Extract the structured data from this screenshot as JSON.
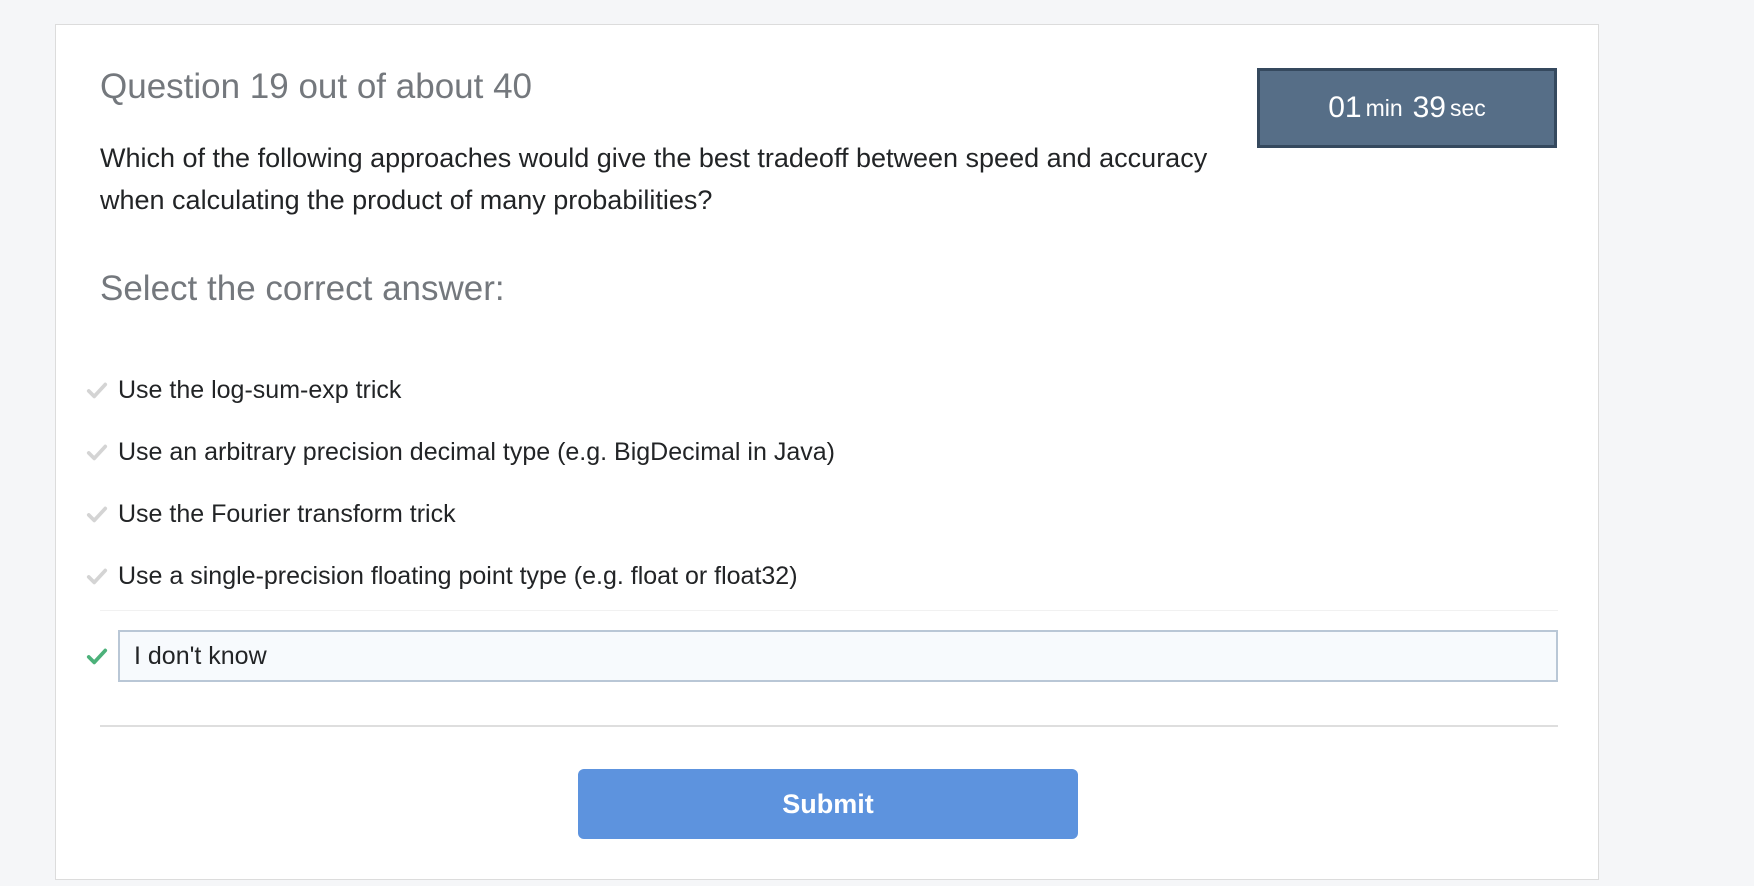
{
  "question": {
    "header": "Question 19 out of about 40",
    "text": "Which of the following approaches would give the best tradeoff between speed and accuracy when calculating the product of many probabilities?"
  },
  "timer": {
    "minutes": "01",
    "min_label": "min",
    "seconds": "39",
    "sec_label": "sec"
  },
  "answers": {
    "prompt": "Select the correct answer:",
    "options": [
      "Use the log-sum-exp trick",
      "Use an arbitrary precision decimal type (e.g. BigDecimal in Java)",
      "Use the Fourier transform trick",
      "Use a single-precision floating point type (e.g. float or float32)"
    ],
    "idk_label": "I don't know",
    "idk_selected": true
  },
  "actions": {
    "submit_label": "Submit"
  },
  "colors": {
    "check_inactive": "#d4d4d4",
    "check_active": "#4cb17a",
    "timer_bg": "#566e87",
    "submit_bg": "#5d93de"
  },
  "icons": {
    "option_check": "checkmark-icon",
    "idk_check": "checkmark-icon"
  }
}
